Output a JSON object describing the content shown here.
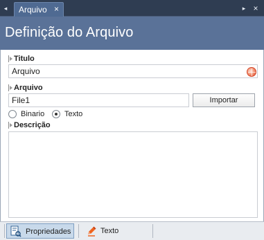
{
  "tab": {
    "label": "Arquivo",
    "close": "×"
  },
  "strip": {
    "left_arrow": "◂",
    "right_arrow": "▸",
    "close": "×"
  },
  "header": {
    "title": "Definição do Arquivo"
  },
  "form": {
    "titulo": {
      "label": "Titulo",
      "value": "Arquivo"
    },
    "arquivo": {
      "label": "Arquivo",
      "value": "File1",
      "import_button": "Importar"
    },
    "format": {
      "options": [
        {
          "label": "Binario",
          "checked": false
        },
        {
          "label": "Texto",
          "checked": true
        }
      ]
    },
    "descricao": {
      "label": "Descrição",
      "value": ""
    }
  },
  "bottom_tabs": [
    {
      "label": "Propriedades",
      "active": true,
      "icon": "properties-icon"
    },
    {
      "label": "Texto",
      "active": false,
      "icon": "text-pencil-icon"
    }
  ]
}
